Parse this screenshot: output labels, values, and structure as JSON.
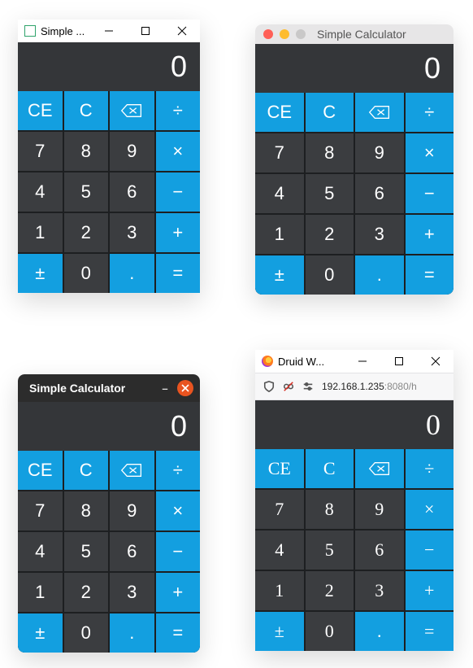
{
  "windows": {
    "win1": {
      "title": "Simple ..."
    },
    "win2": {
      "title": "Simple Calculator"
    },
    "win3": {
      "title": "Simple Calculator"
    },
    "win4": {
      "title": "Druid W...",
      "address": {
        "host": "192.168.1.235",
        "port": ":8080",
        "path": "/h"
      }
    }
  },
  "calc": {
    "display": "0",
    "buttons": {
      "ce": "CE",
      "c": "C",
      "backspace": "⌫",
      "divide": "÷",
      "seven": "7",
      "eight": "8",
      "nine": "9",
      "multiply": "×",
      "four": "4",
      "five": "5",
      "six": "6",
      "minus": "−",
      "one": "1",
      "two": "2",
      "three": "3",
      "plus": "+",
      "plusminus": "±",
      "zero": "0",
      "dot": ".",
      "equals": "="
    }
  },
  "win_buttons": {
    "minimize": "–",
    "maximize": "□",
    "close": "×"
  },
  "gnome_minimize": "–"
}
